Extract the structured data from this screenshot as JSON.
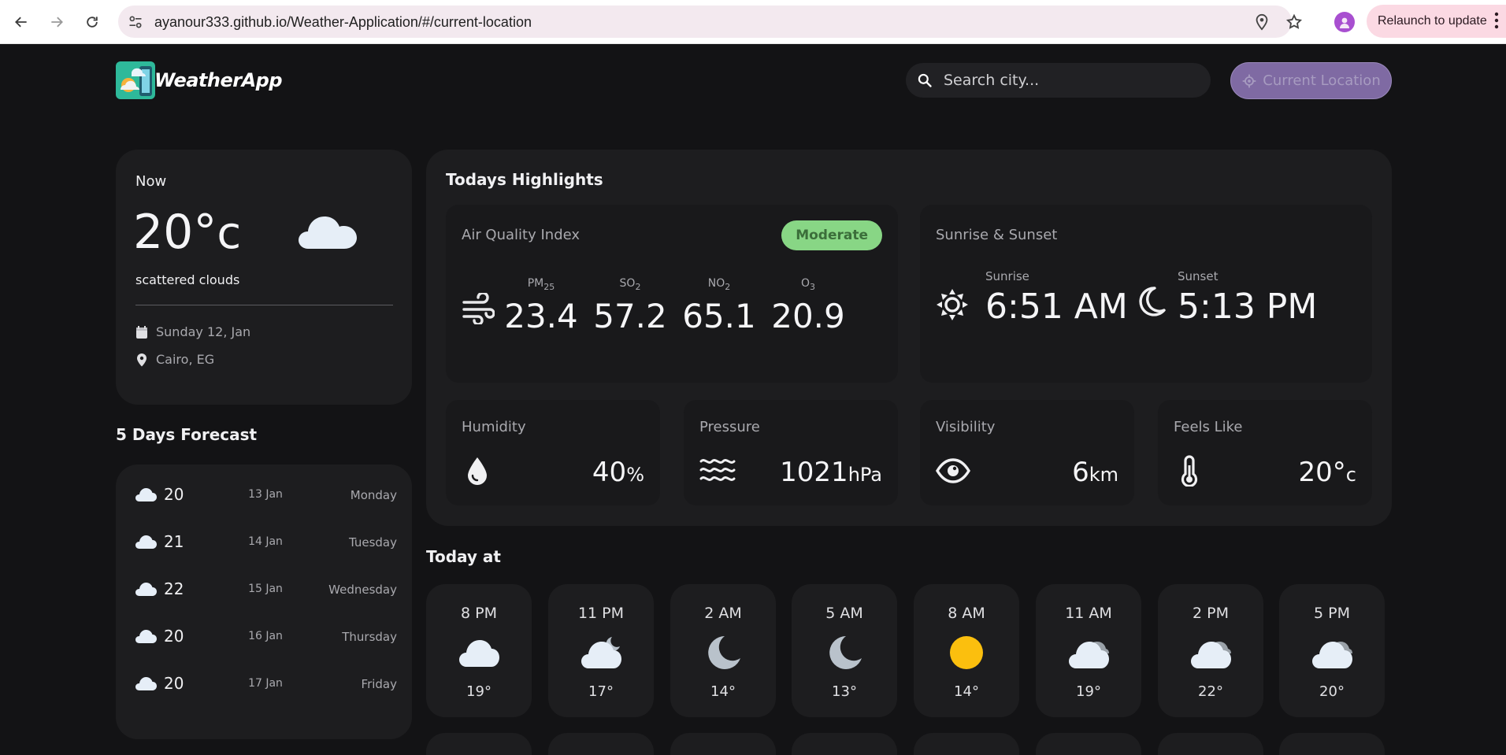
{
  "browser": {
    "url": "ayanour333.github.io/Weather-Application/#/current-location",
    "relaunch_label": "Relaunch to update"
  },
  "header": {
    "brand": "WeatherApp",
    "search_placeholder": "Search city...",
    "location_button": "Current Location"
  },
  "now": {
    "label": "Now",
    "temp": "20°",
    "unit": "c",
    "description": "scattered clouds",
    "date": "Sunday 12, Jan",
    "location": "Cairo, EG",
    "icon": "cloud-icon"
  },
  "forecast": {
    "title": "5 Days Forecast",
    "items": [
      {
        "temp": "20",
        "date": "13 Jan",
        "day": "Monday",
        "icon": "cloud-icon"
      },
      {
        "temp": "21",
        "date": "14 Jan",
        "day": "Tuesday",
        "icon": "cloud-icon"
      },
      {
        "temp": "22",
        "date": "15 Jan",
        "day": "Wednesday",
        "icon": "cloud-icon"
      },
      {
        "temp": "20",
        "date": "16 Jan",
        "day": "Thursday",
        "icon": "cloud-icon"
      },
      {
        "temp": "20",
        "date": "17 Jan",
        "day": "Friday",
        "icon": "cloud-icon"
      }
    ]
  },
  "highlights": {
    "title": "Todays Highlights",
    "aqi": {
      "title": "Air Quality Index",
      "badge": "Moderate",
      "badge_color": "#88d685",
      "items": [
        {
          "label": "PM",
          "sub": "25",
          "value": "23.4"
        },
        {
          "label": "SO",
          "sub": "2",
          "value": "57.2"
        },
        {
          "label": "NO",
          "sub": "2",
          "value": "65.1"
        },
        {
          "label": "O",
          "sub": "3",
          "value": "20.9"
        }
      ]
    },
    "sun": {
      "title": "Sunrise & Sunset",
      "sunrise_label": "Sunrise",
      "sunrise": "6:51 AM",
      "sunset_label": "Sunset",
      "sunset": "5:13 PM"
    },
    "humidity": {
      "title": "Humidity",
      "value": "40",
      "unit": "%"
    },
    "pressure": {
      "title": "Pressure",
      "value": "1021",
      "unit": "hPa"
    },
    "visibility": {
      "title": "Visibility",
      "value": "6",
      "unit": "km"
    },
    "feels_like": {
      "title": "Feels Like",
      "value": "20°",
      "unit": "c"
    }
  },
  "today": {
    "title": "Today at",
    "hours": [
      {
        "time": "8 PM",
        "temp": "19°",
        "icon": "cloud-icon"
      },
      {
        "time": "11 PM",
        "temp": "17°",
        "icon": "cloud-moon-icon"
      },
      {
        "time": "2 AM",
        "temp": "14°",
        "icon": "moon-icon"
      },
      {
        "time": "5 AM",
        "temp": "13°",
        "icon": "moon-icon"
      },
      {
        "time": "8 AM",
        "temp": "14°",
        "icon": "sun-icon"
      },
      {
        "time": "11 AM",
        "temp": "19°",
        "icon": "overcast-cloud-icon"
      },
      {
        "time": "2 PM",
        "temp": "22°",
        "icon": "overcast-cloud-icon"
      },
      {
        "time": "5 PM",
        "temp": "20°",
        "icon": "overcast-cloud-icon"
      }
    ]
  }
}
